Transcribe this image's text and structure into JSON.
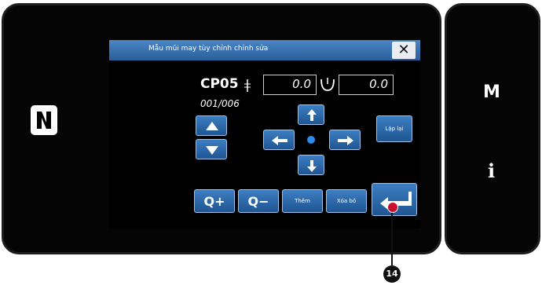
{
  "dialog": {
    "title": "Mẫu mũi may tùy chỉnh chỉnh sửa",
    "close_symbol": "✕"
  },
  "pattern": {
    "code": "CP05",
    "stitch_width": "0.0",
    "stitch_length": "0.0",
    "counter": "001/006"
  },
  "buttons": {
    "repeat_label": "Lặp lại",
    "add_label": "Thêm",
    "delete_label": "Xóa bỏ",
    "zoom_in_label": "Q+",
    "zoom_out_label": "Q−"
  },
  "side": {
    "mode_label": "M",
    "info_label": "i"
  },
  "callout": {
    "number": "14"
  },
  "icons": [
    "nfc-icon",
    "zigzag-stitch-icon",
    "up-arrow-icon",
    "down-arrow-icon",
    "left-arrow-icon",
    "right-arrow-icon",
    "enter-icon"
  ],
  "colors": {
    "button_blue": "#2b6bb0",
    "titlebar": "#3a76b8",
    "callout_marker": "#c8102e"
  }
}
